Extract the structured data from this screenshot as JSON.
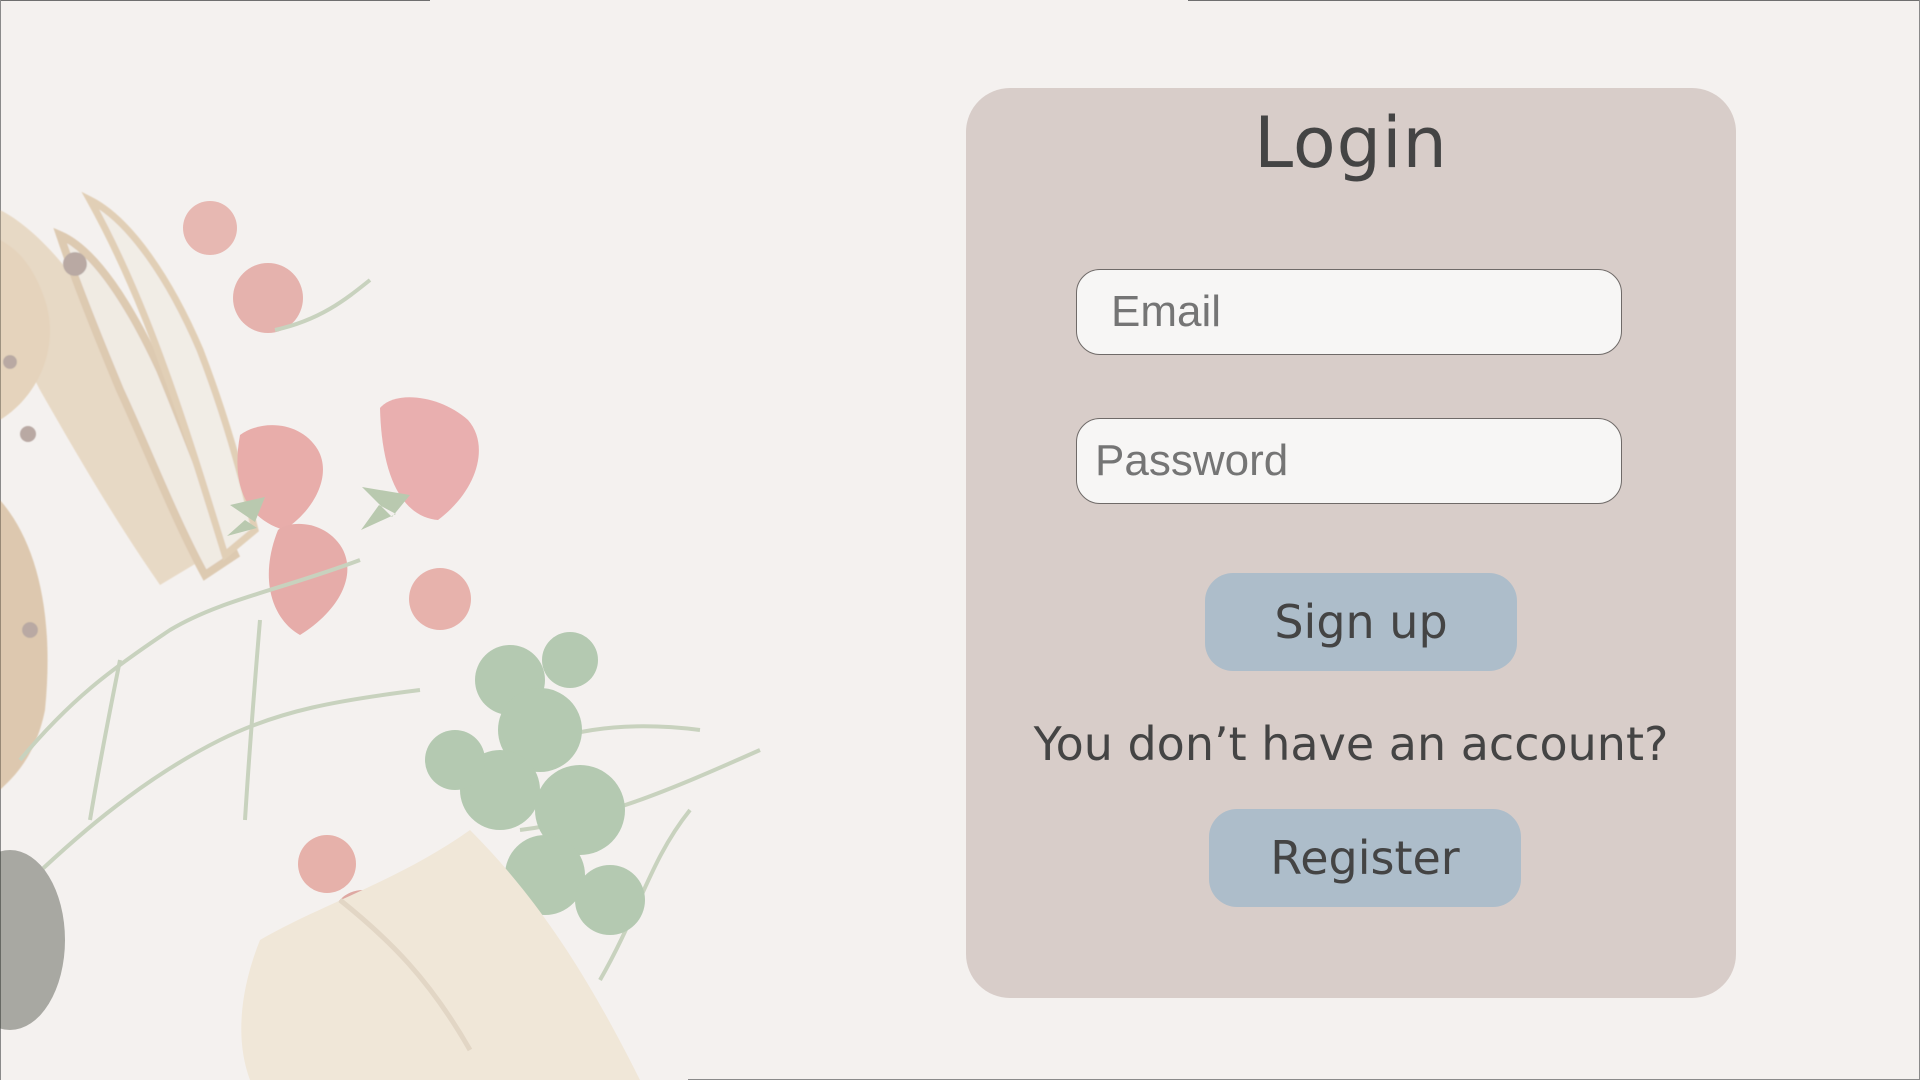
{
  "login": {
    "title": "Login",
    "email_placeholder": "Email",
    "password_placeholder": "Password",
    "signup_label": "Sign up",
    "account_prompt": "You don’t have an account?",
    "register_label": "Register"
  },
  "colors": {
    "page_background": "#f4f1ef",
    "card_background": "#d8cdc9",
    "input_background": "#f7f6f5",
    "button_background": "#adbdca",
    "text": "#444444",
    "placeholder_text": "#c3c0bf"
  },
  "icons": {
    "background_art": "food-background-icon"
  }
}
